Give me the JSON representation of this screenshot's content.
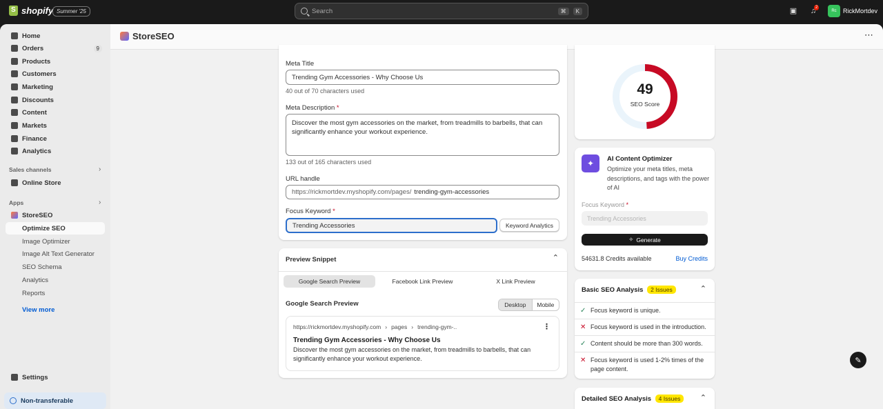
{
  "topbar": {
    "brand": "shopify",
    "edition": "Summer '25",
    "search_placeholder": "Search",
    "shortcut_1": "⌘",
    "shortcut_2": "K",
    "notification_count": "2",
    "user_initials": "Rc",
    "user_name": "RickMortdev"
  },
  "sidebar": {
    "items": [
      {
        "label": "Home"
      },
      {
        "label": "Orders",
        "count": "9"
      },
      {
        "label": "Products"
      },
      {
        "label": "Customers"
      },
      {
        "label": "Marketing"
      },
      {
        "label": "Discounts"
      },
      {
        "label": "Content"
      },
      {
        "label": "Markets"
      },
      {
        "label": "Finance"
      },
      {
        "label": "Analytics"
      }
    ],
    "sales_channels_label": "Sales channels",
    "online_store": "Online Store",
    "apps_label": "Apps",
    "app_name": "StoreSEO",
    "app_sub": [
      "Optimize SEO",
      "Image Optimizer",
      "Image Alt Text Generator",
      "SEO Schema",
      "Analytics",
      "Reports"
    ],
    "view_more": "View more",
    "settings": "Settings",
    "non_transferable": "Non-transferable"
  },
  "app": {
    "title": "StoreSEO",
    "more": "⋯"
  },
  "form": {
    "meta_title_label": "Meta Title",
    "meta_title_value": "Trending Gym Accessories - Why Choose Us",
    "meta_title_help": "40 out of 70 characters used",
    "meta_desc_label": "Meta Description",
    "meta_desc_value": "Discover the most gym accessories on the market, from treadmills to barbells, that can significantly enhance your workout experience.",
    "meta_desc_help": "133 out of 165 characters used",
    "url_label": "URL handle",
    "url_prefix": "https://rickmortdev.myshopify.com/pages/",
    "url_value": "trending-gym-accessories",
    "focus_label": "Focus Keyword",
    "focus_value": "Trending Accessories",
    "keyword_analytics": "Keyword Analytics",
    "required_mark": "*"
  },
  "preview": {
    "title": "Preview Snippet",
    "tabs": [
      "Google Search Preview",
      "Facebook Link Preview",
      "X Link Preview"
    ],
    "subheading": "Google Search Preview",
    "desktop": "Desktop",
    "mobile": "Mobile",
    "breadcrumb_domain": "https://rickmortdev.myshopify.com",
    "breadcrumb_1": "pages",
    "breadcrumb_2": "trending-gym-..",
    "serp_title": "Trending Gym Accessories - Why Choose Us",
    "serp_desc": "Discover the most gym accessories on the market, from treadmills to barbells, that can significantly enhance your workout experience."
  },
  "score": {
    "value": "49",
    "label": "SEO Score",
    "fraction": 0.49,
    "ring_color": "#c70a24",
    "track_color": "#eaf4fb"
  },
  "ai": {
    "title": "AI Content Optimizer",
    "desc": "Optimize your meta titles, meta descriptions, and tags with the power of AI",
    "focus_label": "Focus Keyword",
    "focus_placeholder": "Trending Accessories",
    "generate": "Generate",
    "credits": "54631.8 Credits available",
    "buy": "Buy Credits"
  },
  "basic": {
    "title": "Basic SEO Analysis",
    "issues": "2 Issues",
    "checks": [
      {
        "text": "Focus keyword is unique.",
        "ok": true
      },
      {
        "text": "Focus keyword is used in the introduction.",
        "ok": false
      },
      {
        "text": "Content should be more than 300 words.",
        "ok": true
      },
      {
        "text": "Focus keyword is used 1-2% times of the page content.",
        "ok": false
      }
    ]
  },
  "detailed": {
    "title": "Detailed SEO Analysis",
    "issues": "4 Issues"
  }
}
